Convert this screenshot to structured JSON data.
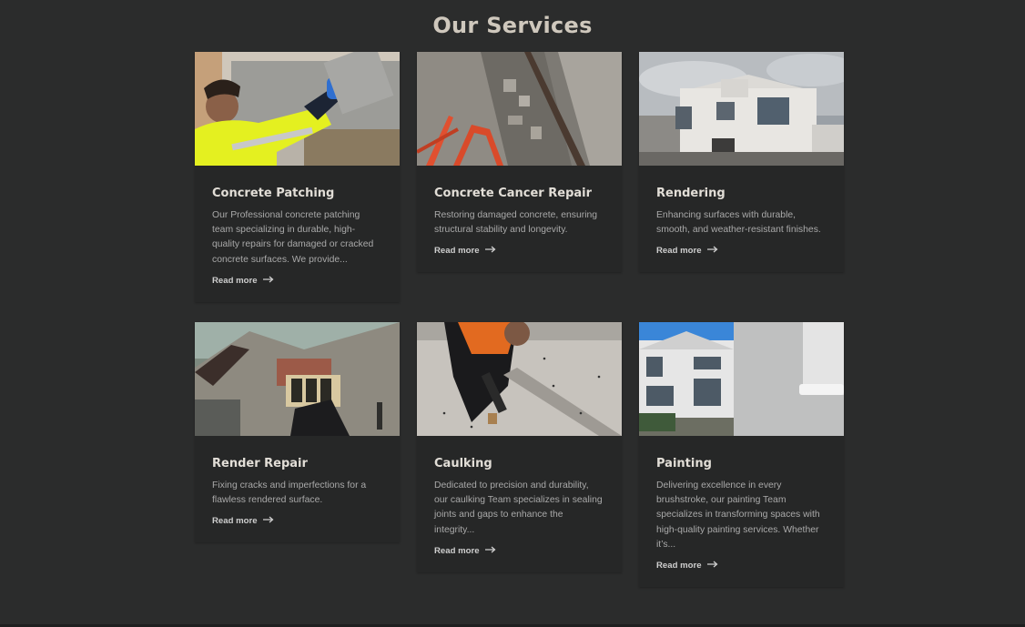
{
  "section": {
    "heading": "Our Services"
  },
  "cards": [
    {
      "title": "Concrete Patching",
      "description": "Our Professional concrete patching team specializing in durable, high-quality repairs for damaged or cracked concrete surfaces. We provide...",
      "link": "Read more",
      "image": "worker-plastering-wall-photo"
    },
    {
      "title": "Concrete Cancer Repair",
      "description": "Restoring damaged concrete, ensuring structural stability and longevity.",
      "link": "Read more",
      "image": "exposed-rebar-concrete-photo"
    },
    {
      "title": "Rendering",
      "description": "Enhancing surfaces with durable, smooth, and weather-resistant finishes.",
      "link": "Read more",
      "image": "white-rendered-house-photo"
    },
    {
      "title": "Render Repair",
      "description": "Fixing cracks and imperfections for a flawless rendered surface.",
      "link": "Read more",
      "image": "damaged-render-wall-photo"
    },
    {
      "title": "Caulking",
      "description": "Dedicated to precision and durability, our caulking Team specializes in sealing joints and gaps to enhance the integrity...",
      "link": "Read more",
      "image": "worker-caulking-floor-photo"
    },
    {
      "title": "Painting",
      "description": "Delivering excellence in every brushstroke, our painting Team specializes in transforming spaces with high-quality painting services. Whether it’s...",
      "link": "Read more",
      "image": "house-and-paint-roller-photo"
    }
  ],
  "colors": {
    "background": "#2b2c2c",
    "card": "#262727",
    "heading": "#cfc8bd"
  },
  "icons": {
    "link_arrow": "arrow-right-icon"
  }
}
